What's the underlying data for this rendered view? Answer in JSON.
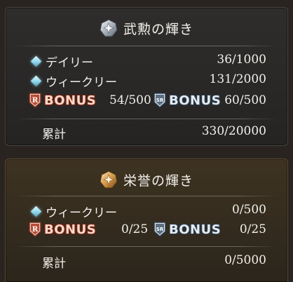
{
  "panels": [
    {
      "title": "武勲の輝き",
      "icon": "silver-star-emblem-icon",
      "accent": "#9aa3ad",
      "rows": [
        {
          "label": "デイリー",
          "value": "36/1000"
        },
        {
          "label": "ウィークリー",
          "value": "131/2000"
        }
      ],
      "bonus": {
        "r_label": "BONUS",
        "r_value": "54/500",
        "sr_label": "BONUS",
        "sr_value": "60/500"
      },
      "total": {
        "label": "累計",
        "value": "330/20000"
      }
    },
    {
      "title": "栄誉の輝き",
      "icon": "gold-star-emblem-icon",
      "accent": "#d9a35a",
      "rows": [
        {
          "label": "ウィークリー",
          "value": "0/500"
        }
      ],
      "bonus": {
        "r_label": "BONUS",
        "r_value": "0/25",
        "sr_label": "BONUS",
        "sr_value": "0/25"
      },
      "total": {
        "label": "累計",
        "value": "0/5000"
      }
    }
  ],
  "badges": {
    "r": "R",
    "sr": "SR"
  }
}
